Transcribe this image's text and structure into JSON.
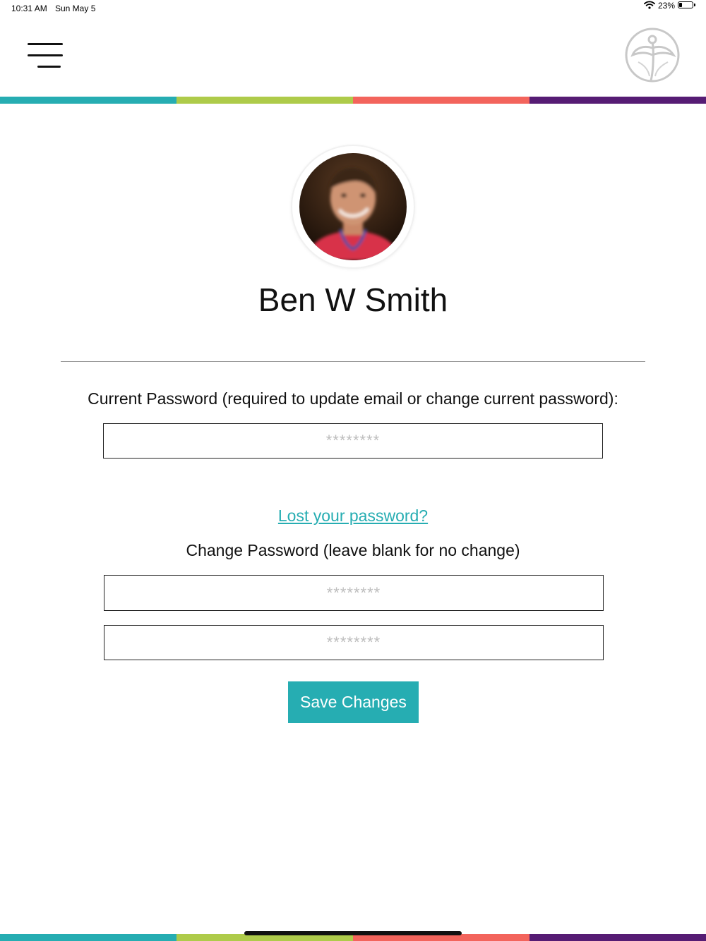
{
  "status_bar": {
    "time": "10:31 AM",
    "date": "Sun May 5",
    "battery_percent": "23%",
    "battery_level": 0.23
  },
  "header": {
    "menu_icon": "hamburger-menu-icon",
    "logo_icon": "brand-logo"
  },
  "colors": {
    "teal": "#26adb2",
    "lime": "#aecb4a",
    "coral": "#f3645c",
    "purple": "#561c74"
  },
  "profile": {
    "name": "Ben W Smith",
    "avatar": "user-photo"
  },
  "form": {
    "current_password_label": "Current Password (required to update email or change current password):",
    "current_password_placeholder": "********",
    "lost_password_link": "Lost your password?",
    "change_password_label": "Change Password (leave blank for no change)",
    "new_password_placeholder": "********",
    "confirm_password_placeholder": "********",
    "save_label": "Save Changes"
  }
}
